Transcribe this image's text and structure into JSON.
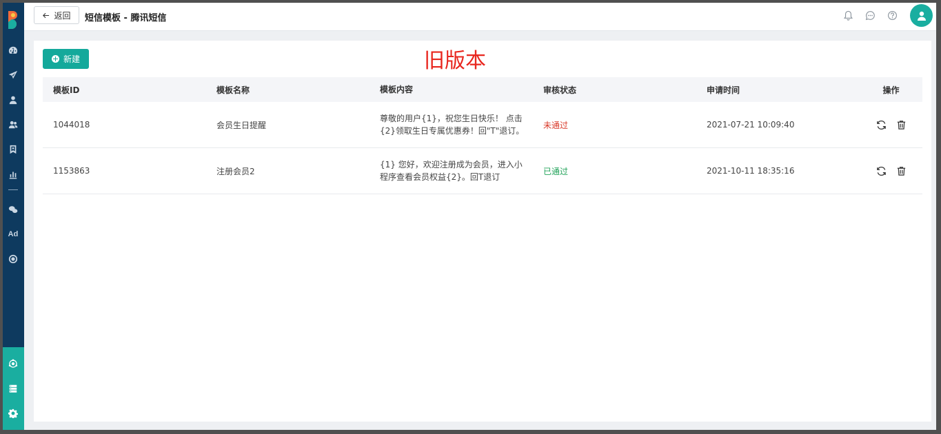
{
  "header": {
    "back_label": "返回",
    "title": "短信模板 - 腾讯短信",
    "icons": [
      "bell-icon",
      "chat-icon",
      "help-icon",
      "user-icon"
    ]
  },
  "sidebar": {
    "ad_label": "Ad",
    "icons": [
      "dashboard-icon",
      "send-icon",
      "user-icon",
      "users-icon",
      "bookmark-icon",
      "chart-icon",
      "wechat-icon",
      "ad-icon",
      "target-icon",
      "network-icon",
      "server-icon",
      "gear-icon"
    ]
  },
  "toolbar": {
    "new_label": "新建"
  },
  "version_label": "旧版本",
  "table": {
    "columns": [
      "模板ID",
      "模板名称",
      "模板内容",
      "审核状态",
      "申请时间",
      "操作"
    ],
    "rows": [
      {
        "id": "1044018",
        "name": "会员生日提醒",
        "content_line1": "尊敬的用户{1}，祝您生日快乐！ 点击",
        "content_line2": "{2}领取生日专属优惠券！回\"T\"退订。",
        "status": "未通过",
        "time": "2021-07-21 10:09:40"
      },
      {
        "id": "1153863",
        "name": "注册会员2",
        "content_line1": "{1} 您好，欢迎注册成为会员，进入小",
        "content_line2": "程序查看会员权益{2}。回T退订",
        "status": "已通过",
        "time": "2021-10-11 18:35:16"
      }
    ]
  },
  "colors": {
    "sidebar_bg": "#0e3a5f",
    "accent": "#14a99b",
    "status_fail": "#d93b2b",
    "status_pass": "#22a35a",
    "version_label": "#e8261e"
  }
}
